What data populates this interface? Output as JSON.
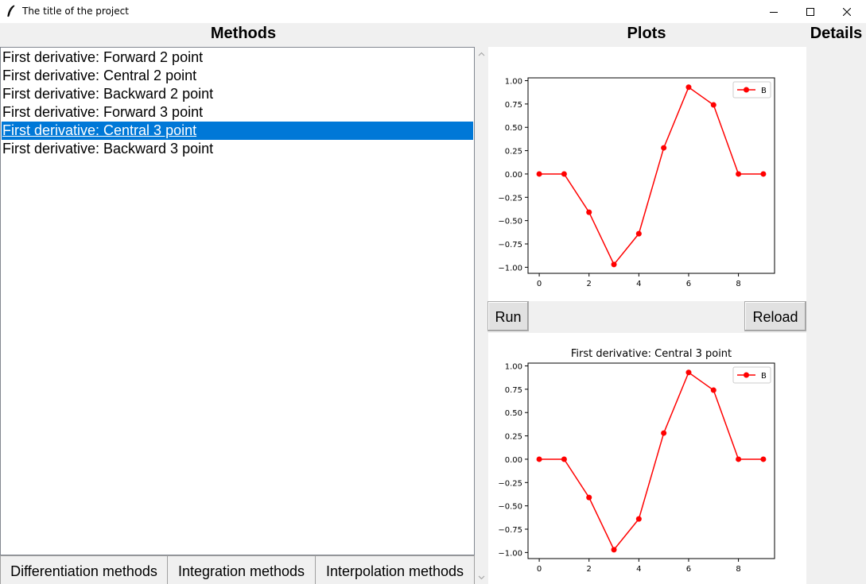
{
  "window": {
    "title": "The title of the project",
    "icon": "feather-icon",
    "controls": [
      "minimize-icon",
      "maximize-icon",
      "close-icon"
    ]
  },
  "headings": {
    "methods": "Methods",
    "plots": "Plots",
    "details": "Details"
  },
  "methods_list": {
    "items": [
      "First derivative: Forward 2 point",
      "First derivative: Central 2 point",
      "First derivative: Backward 2 point",
      "First derivative: Forward 3 point",
      "First derivative: Central 3 point",
      "First derivative: Backward 3 point"
    ],
    "selected_index": 4
  },
  "tabs": [
    "Differentiation methods",
    "Integration methods",
    "Interpolation methods"
  ],
  "buttons": {
    "run": "Run",
    "reload": "Reload"
  },
  "colors": {
    "selection": "#0078d7",
    "series": "#ff0000"
  },
  "chart_data": [
    {
      "type": "line",
      "title": "",
      "x": [
        0,
        1,
        2,
        3,
        4,
        5,
        6,
        7,
        8,
        9
      ],
      "series": [
        {
          "name": "B",
          "values": [
            0,
            0,
            -0.41,
            -0.97,
            -0.64,
            0.28,
            0.93,
            0.74,
            0,
            0
          ]
        }
      ],
      "xticks": [
        "0",
        "2",
        "4",
        "6",
        "8"
      ],
      "yticks": [
        "1.00",
        "0.75",
        "0.50",
        "0.25",
        "0.00",
        "−0.25",
        "−0.50",
        "−0.75",
        "−1.00"
      ],
      "xlim": [
        -0.45,
        9.45
      ],
      "ylim": [
        -1.065,
        1.03
      ],
      "legend": "top-right",
      "grid": false
    },
    {
      "type": "line",
      "title": "First derivative: Central 3 point",
      "x": [
        0,
        1,
        2,
        3,
        4,
        5,
        6,
        7,
        8,
        9
      ],
      "series": [
        {
          "name": "B",
          "values": [
            0,
            0,
            -0.41,
            -0.97,
            -0.64,
            0.28,
            0.93,
            0.74,
            0,
            0
          ]
        }
      ],
      "xticks": [
        "0",
        "2",
        "4",
        "6",
        "8"
      ],
      "yticks": [
        "1.00",
        "0.75",
        "0.50",
        "0.25",
        "0.00",
        "−0.25",
        "−0.50",
        "−0.75",
        "−1.00"
      ],
      "xlim": [
        -0.45,
        9.45
      ],
      "ylim": [
        -1.065,
        1.03
      ],
      "legend": "top-right",
      "grid": false
    }
  ]
}
